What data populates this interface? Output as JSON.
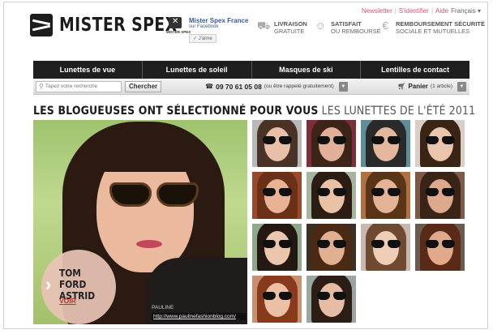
{
  "header": {
    "top_links": {
      "newsletter": "Newsletter",
      "login": "S'identifier",
      "help": "Aide",
      "language": "Français"
    },
    "logo_text": "MISTER SPEX",
    "facebook": {
      "icon_caption": "MISTER SPEX",
      "title": "Mister Spex France",
      "subtitle": "sur Facebook",
      "like_label": "J'aime"
    },
    "features": [
      {
        "icon": "truck-icon",
        "line1": "LIVRAISON",
        "line2": "GRATUITE"
      },
      {
        "icon": "smiley-icon",
        "line1": "SATISFAIT",
        "line2": "OU REMBOURSÉ"
      },
      {
        "icon": "euro-icon",
        "line1": "REMBOURSEMENT SÉCURITÉ",
        "line2": "SOCIALE ET MUTUELLES"
      }
    ]
  },
  "nav": {
    "items": [
      "Lunettes de vue",
      "Lunettes de soleil",
      "Masques de ski",
      "Lentilles de contact"
    ]
  },
  "toolbar": {
    "search_placeholder": "Tapez votre recherche",
    "search_button": "Chercher",
    "phone_number": "09 70 61 05 08",
    "phone_callback": "(ou être rappelé gratuitement)",
    "cart_label": "Panier",
    "cart_count": "(1 article)"
  },
  "main": {
    "headline_bold": "LES BLOGUEUSES ONT SÉLECTIONNÉ POUR VOUS",
    "headline_light": "LES LUNETTES DE L'ÉTÉ 2011",
    "hero": {
      "brand_line1": "TOM FORD",
      "brand_line2": "ASTRID",
      "link_label": "VOIR",
      "credit_name": "PAULINE",
      "credit_url": "http://www.paulinefashionblog.com/"
    }
  },
  "colors": {
    "nav_background": "#1f1f1f",
    "link_blue": "#3b5998",
    "accent_pink": "#d94f72",
    "voir_red": "#b33a2e"
  }
}
